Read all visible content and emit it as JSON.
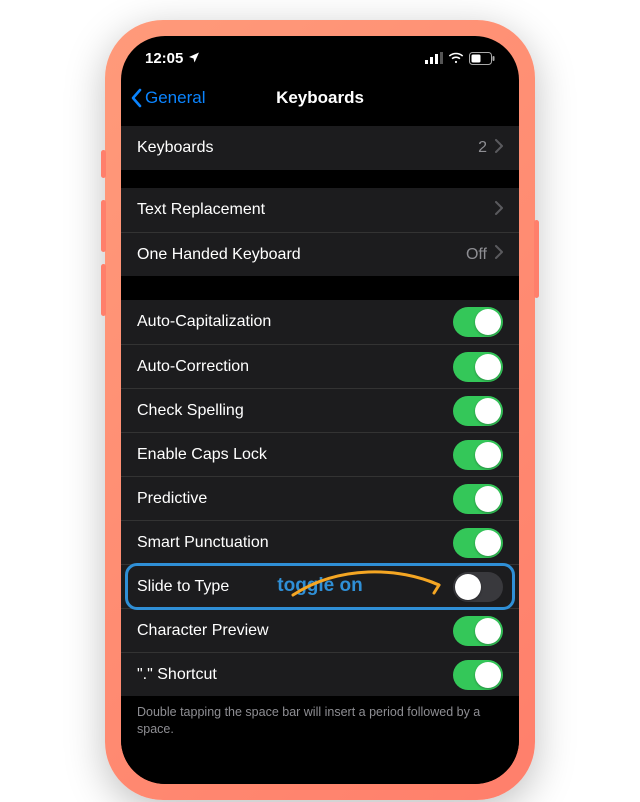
{
  "status": {
    "time": "12:05"
  },
  "nav": {
    "back": "General",
    "title": "Keyboards"
  },
  "groups": {
    "g1": {
      "keyboards_label": "Keyboards",
      "keyboards_value": "2"
    },
    "g2": {
      "text_replacement": "Text Replacement",
      "one_handed": "One Handed Keyboard",
      "one_handed_value": "Off"
    },
    "g3": {
      "auto_cap": "Auto-Capitalization",
      "auto_correct": "Auto-Correction",
      "check_spell": "Check Spelling",
      "caps_lock": "Enable Caps Lock",
      "predictive": "Predictive",
      "smart_punct": "Smart Punctuation",
      "slide_type": "Slide to Type",
      "char_preview": "Character Preview",
      "dot_shortcut": "\".\" Shortcut"
    }
  },
  "annotation": {
    "label": "toggle on"
  },
  "footer": "Double tapping the space bar will insert a period followed by a space."
}
